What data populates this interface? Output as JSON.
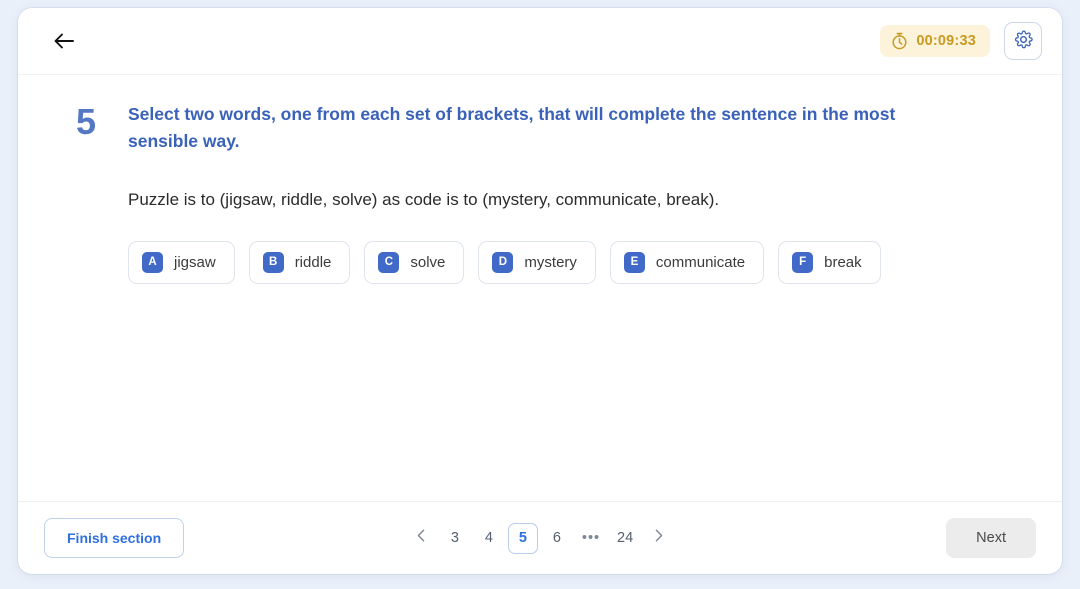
{
  "header": {
    "back_icon": "arrow-left-icon",
    "timer": {
      "icon": "stopwatch-icon",
      "value": "00:09:33",
      "bg_color": "#fdf3da",
      "text_color": "#c79a23"
    },
    "settings_icon": "gear-icon"
  },
  "question": {
    "number": "5",
    "prompt": "Select two words, one from each set of brackets, that will complete the sentence in the most sensible way.",
    "sentence": "Puzzle is to (jigsaw, riddle, solve) as code is to (mystery, communicate, break).",
    "options": [
      {
        "letter": "A",
        "label": "jigsaw"
      },
      {
        "letter": "B",
        "label": "riddle"
      },
      {
        "letter": "C",
        "label": "solve"
      },
      {
        "letter": "D",
        "label": "mystery"
      },
      {
        "letter": "E",
        "label": "communicate"
      },
      {
        "letter": "F",
        "label": "break"
      }
    ]
  },
  "footer": {
    "finish_label": "Finish section",
    "next_label": "Next",
    "pagination": {
      "prev_icon": "chevron-left-icon",
      "next_icon": "chevron-right-icon",
      "pages": [
        "3",
        "4",
        "5",
        "6",
        "…",
        "24"
      ],
      "current": "5",
      "ellipsis": "•••"
    }
  },
  "colors": {
    "accent_blue": "#3a62b8",
    "badge_blue": "#4069c8",
    "link_blue": "#2f6fe0",
    "page_bg": "#eaf0fa",
    "card_bg": "#ffffff"
  }
}
